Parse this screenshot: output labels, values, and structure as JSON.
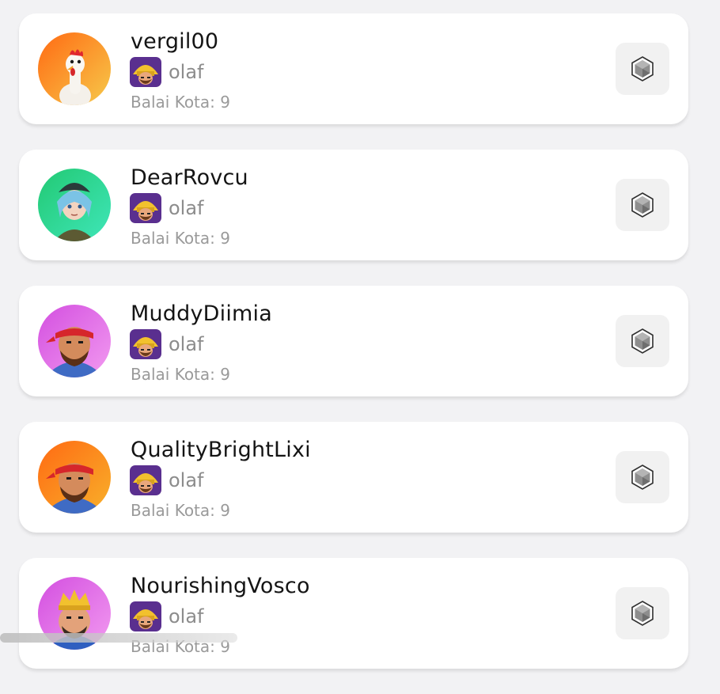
{
  "players": [
    {
      "username": "vergil00",
      "clan": "olaf",
      "town_hall": "Balai Kota: 9",
      "avatar": "chicken-avatar"
    },
    {
      "username": "DearRovcu",
      "clan": "olaf",
      "town_hall": "Balai Kota: 9",
      "avatar": "anime-girl-avatar"
    },
    {
      "username": "MuddyDiimia",
      "clan": "olaf",
      "town_hall": "Balai Kota: 9",
      "avatar": "barbarian-headband-avatar"
    },
    {
      "username": "QualityBrightLixi",
      "clan": "olaf",
      "town_hall": "Balai Kota: 9",
      "avatar": "barbarian-headband-avatar"
    },
    {
      "username": "NourishingVosco",
      "clan": "olaf",
      "town_hall": "Balai Kota: 9",
      "avatar": "king-avatar"
    }
  ],
  "icons": {
    "game": "clash-of-clans-barbarian-icon",
    "action": "hexagon-gem-icon"
  },
  "colors": {
    "background": "#f2f2f4",
    "card": "#ffffff",
    "button": "#f1f1f1",
    "username": "#141414",
    "muted": "#8c8c8c"
  }
}
